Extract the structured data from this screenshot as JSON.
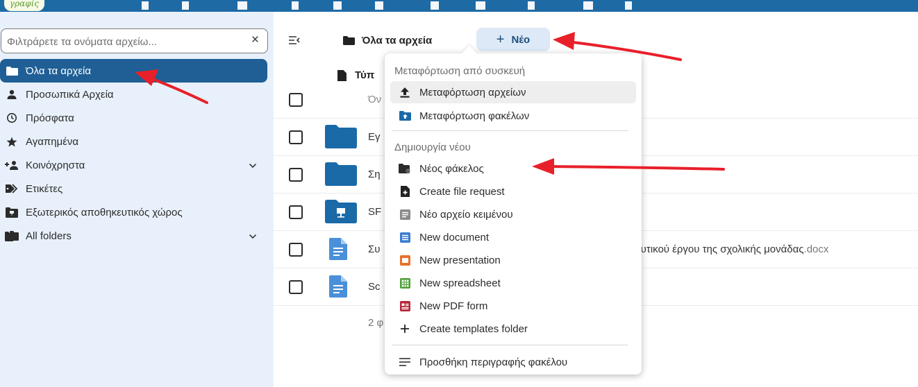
{
  "header": {
    "brand": "γραφίς"
  },
  "sidebar": {
    "filter_placeholder": "Φιλτράρετε τα ονόματα αρχείω...",
    "clear_symbol": "×",
    "items": [
      {
        "label": "Όλα τα αρχεία",
        "icon": "folder-icon",
        "active": true
      },
      {
        "label": "Προσωπικά Αρχεία",
        "icon": "user-icon"
      },
      {
        "label": "Πρόσφατα",
        "icon": "history-icon"
      },
      {
        "label": "Αγαπημένα",
        "icon": "star-icon"
      },
      {
        "label": "Κοινόχρηστα",
        "icon": "share-icon",
        "expandable": true
      },
      {
        "label": "Ετικέτες",
        "icon": "tag-icon"
      },
      {
        "label": "Εξωτερικός αποθηκευτικός χώρος",
        "icon": "external-storage-icon"
      },
      {
        "label": "All folders",
        "icon": "folders-icon",
        "expandable": true
      }
    ]
  },
  "main": {
    "breadcrumb": "Όλα τα αρχεία",
    "new_button": {
      "symbol": "+",
      "label": "Νέο"
    },
    "column_header": "Τύπ",
    "select_all_label": "Όν",
    "rows": [
      {
        "name": "Εγ",
        "type": "folder"
      },
      {
        "name": "Ση",
        "type": "folder"
      },
      {
        "name": "SF",
        "type": "external-folder"
      },
      {
        "name": "Συ",
        "tail": "ευτικού έργου της σχολικής μονάδας",
        "ext": ".docx",
        "type": "document"
      },
      {
        "name": "Sc",
        "type": "document"
      }
    ],
    "summary": "2 φ"
  },
  "menu": {
    "section_upload": "Μεταφόρτωση από συσκευή",
    "upload_files": "Μεταφόρτωση αρχείων",
    "upload_folders": "Μεταφόρτωση φακέλων",
    "section_create": "Δημιουργία νέου",
    "new_folder": "Νέος φάκελος",
    "create_file_request": "Create file request",
    "new_text_file": "Νέο αρχείο κειμένου",
    "new_document": "New document",
    "new_presentation": "New presentation",
    "new_spreadsheet": "New spreadsheet",
    "new_pdf_form": "New PDF form",
    "create_templates_folder": "Create templates folder",
    "add_folder_description": "Προσθήκη περιγραφής φακέλου"
  },
  "colors": {
    "header": "#1e6aa5",
    "sidebar_bg": "#e8f1fb",
    "active_item": "#1f5f95",
    "folder": "#1a6aa8",
    "annotation_arrow": "#e8202a"
  }
}
